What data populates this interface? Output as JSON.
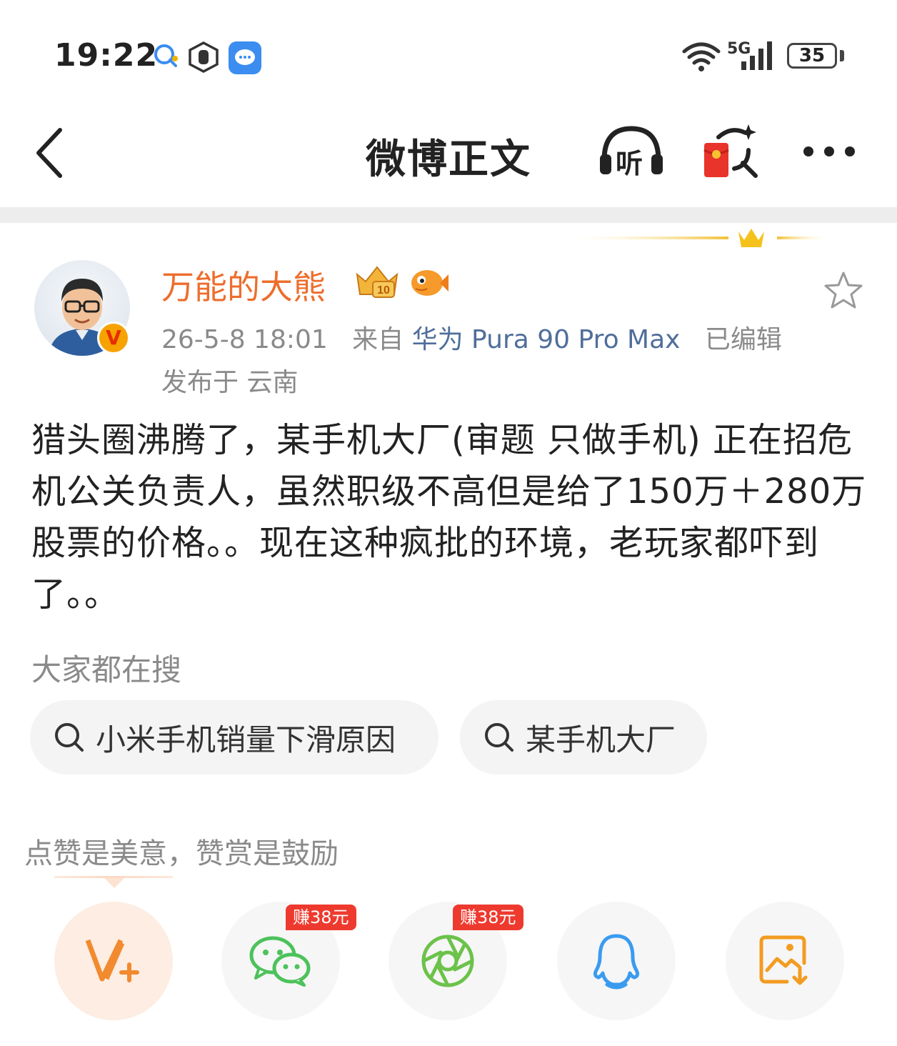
{
  "status_bar": {
    "time": "19:22",
    "network": "5G",
    "battery": "35",
    "icons": [
      "chat-bubble-icon",
      "hand-shield-icon",
      "message-app-icon",
      "wifi-icon",
      "signal-icon"
    ]
  },
  "header": {
    "title": "微博正文",
    "listen_label": "听",
    "back_icon": "chevron-left-icon",
    "more_icon": "more-dots-icon"
  },
  "author": {
    "name": "万能的大熊",
    "verified_badge": "V",
    "timestamp": "26-5-8 18:01",
    "source_prefix": "来自",
    "device": "华为 Pura 90 Pro Max",
    "edited": "已编辑",
    "location": "发布于 云南"
  },
  "post": {
    "text": "猎头圈沸腾了，某手机大厂(审题 只做手机) 正在招危机公关负责人，虽然职级不高但是给了150万＋280万股票的价格。。现在这种疯批的环境，老玩家都吓到了。。"
  },
  "search": {
    "heading": "大家都在搜",
    "chips": [
      {
        "label": "小米手机销量下滑原因"
      },
      {
        "label": "某手机大厂"
      }
    ]
  },
  "reward": {
    "note": "点赞是美意，赞赏是鼓励",
    "buttons": [
      {
        "icon": "v-plus-icon",
        "badge": ""
      },
      {
        "icon": "wechat-icon",
        "badge": "赚38元"
      },
      {
        "icon": "moments-icon",
        "badge": "赚38元"
      },
      {
        "icon": "qq-icon",
        "badge": ""
      },
      {
        "icon": "save-image-icon",
        "badge": ""
      }
    ]
  },
  "colors": {
    "author_name": "#ee6d2c",
    "device_link": "#4f6e9b",
    "meta_gray": "#8a8a8a",
    "earn_badge": "#ee3a2e",
    "wechat_green": "#4cc25b",
    "qq_blue": "#3a9bf0",
    "accent_orange": "#f39c22"
  }
}
